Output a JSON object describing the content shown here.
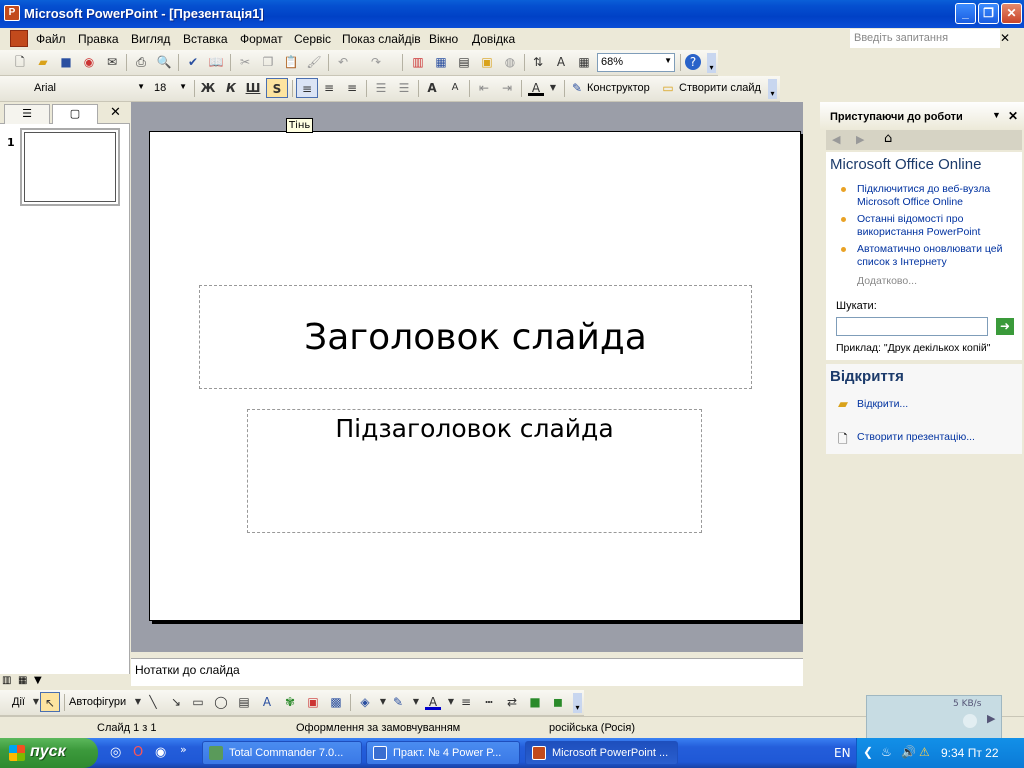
{
  "window": {
    "title": "Microsoft PowerPoint - [Презентація1]"
  },
  "menu": {
    "items": [
      "Файл",
      "Правка",
      "Вигляд",
      "Вставка",
      "Формат",
      "Сервіс",
      "Показ слайдів",
      "Вікно",
      "Довідка"
    ],
    "ask_placeholder": "Введіть запитання"
  },
  "toolbar": {
    "zoom": "68%",
    "font_name": "Arial",
    "font_size": "18",
    "bold_label": "Ж",
    "italic_label": "К",
    "underline_label": "Ш",
    "shadow_label": "S",
    "designer_label": "Конструктор",
    "new_slide_label": "Створити слайд"
  },
  "tooltip": "Тінь",
  "slides_panel": {
    "slide_number": "1"
  },
  "slide": {
    "title_placeholder": "Заголовок слайда",
    "subtitle_placeholder": "Підзаголовок слайда"
  },
  "notes": {
    "placeholder": "Нотатки до слайда"
  },
  "task_pane": {
    "title": "Приступаючи до роботи",
    "office_online_heading": "Microsoft Office Online",
    "links": [
      "Підключитися до веб-вузла Microsoft Office Online",
      "Останні відомості про використання PowerPoint",
      "Автоматично оновлювати цей список з Інтернету"
    ],
    "more_label": "Додатково...",
    "search_label": "Шукати:",
    "search_value": "",
    "example_text": "Приклад: \"Друк декількох копій\"",
    "open_heading": "Відкриття",
    "open_link": "Відкрити...",
    "create_link": "Створити презентацію..."
  },
  "draw_toolbar": {
    "actions_label": "Дії",
    "autoshapes_label": "Автофігури"
  },
  "status_bar": {
    "slide_info": "Слайд 1 з 1",
    "design": "Оформлення за замовчуванням",
    "language": "російська (Росія)"
  },
  "net_meter": {
    "speed": "5 KB/s"
  },
  "taskbar": {
    "start_label": "пуск",
    "tasks": [
      "Total Commander 7.0...",
      "Практ. № 4 Power P...",
      "Microsoft PowerPoint ..."
    ],
    "lang": "EN",
    "clock": "9:34 Пт 22"
  },
  "colors": {
    "accent": "#0032a0",
    "title_bar": "#0a4ed6",
    "start_green": "#3c9a3c"
  }
}
